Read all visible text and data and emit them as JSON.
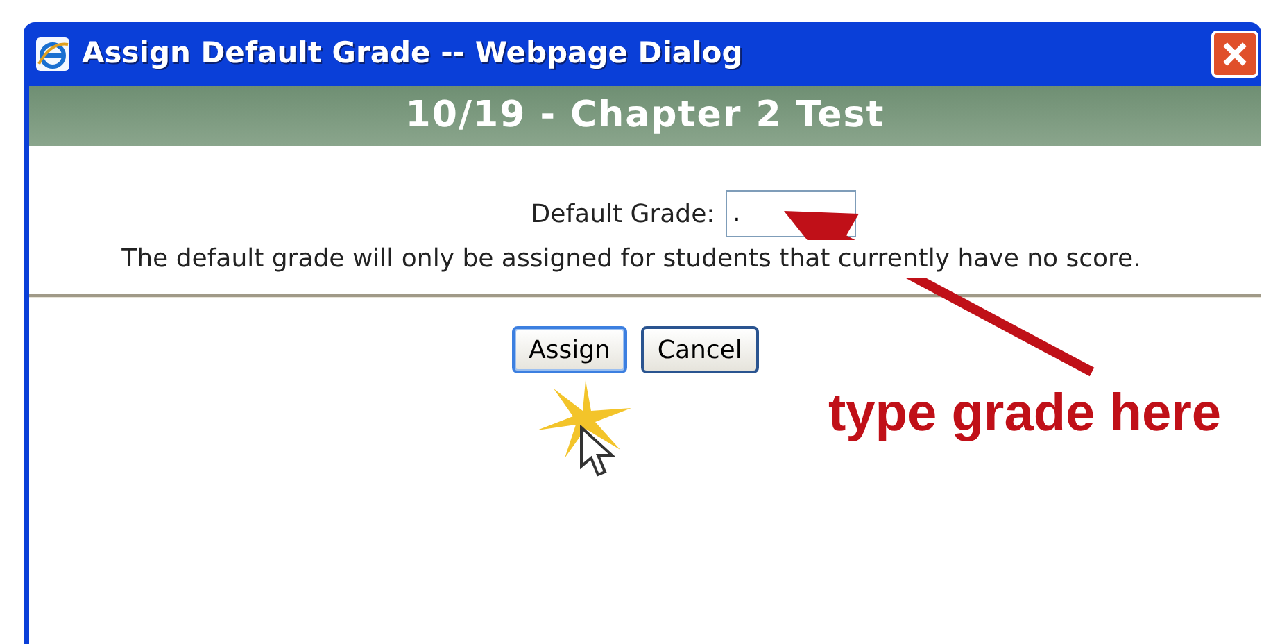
{
  "window": {
    "title": "Assign Default Grade -- Webpage Dialog"
  },
  "header": {
    "title": "10/19 - Chapter 2 Test"
  },
  "form": {
    "label": "Default Grade:",
    "value": ".",
    "note": "The default grade will only be assigned for students that currently have no score."
  },
  "buttons": [
    {
      "label": "Assign",
      "focused": true
    },
    {
      "label": "Cancel",
      "focused": false
    }
  ],
  "annotation": {
    "text": "type grade here"
  }
}
